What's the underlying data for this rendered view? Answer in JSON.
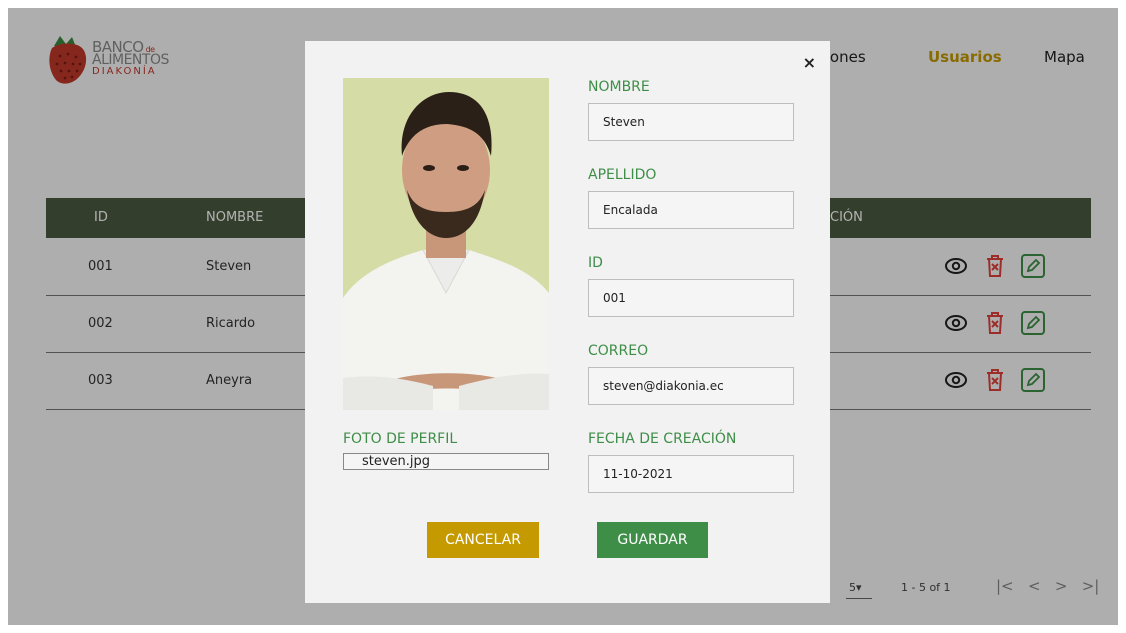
{
  "brand": {
    "line1": "BANCO",
    "line1_small": "de",
    "line2": "ALIMENTOS",
    "line3": "DIAKONÍA"
  },
  "nav": {
    "item_a": "uciones",
    "item_active": "Usuarios",
    "item_c": "Mapa"
  },
  "table": {
    "headers": {
      "id": "ID",
      "nombre": "NOMBRE",
      "right_partial": "CIÓN"
    },
    "rows": [
      {
        "id": "001",
        "nombre": "Steven"
      },
      {
        "id": "002",
        "nombre": "Ricardo"
      },
      {
        "id": "003",
        "nombre": "Aneyra"
      }
    ]
  },
  "pagination": {
    "per_page": "5",
    "range": "1 - 5 of 1"
  },
  "modal": {
    "close_label": "×",
    "photo_label": "FOTO DE PERFIL",
    "photo_file": "steven.jpg",
    "fields": {
      "nombre": {
        "label": "NOMBRE",
        "value": "Steven"
      },
      "apellido": {
        "label": "APELLIDO",
        "value": "Encalada"
      },
      "id": {
        "label": "ID",
        "value": "001"
      },
      "correo": {
        "label": "CORREO",
        "value": "steven@diakonia.ec"
      },
      "fecha": {
        "label": "FECHA DE CREACIÓN",
        "value": "11-10-2021"
      }
    },
    "cancel_label": "CANCELAR",
    "save_label": "GUARDAR"
  },
  "colors": {
    "accent_gold": "#c49a00",
    "accent_green": "#3e8e47",
    "header_dark": "#4a5a40",
    "danger": "#e0413a"
  },
  "icons": [
    "strawberry-logo",
    "eye-icon",
    "trash-icon",
    "edit-icon",
    "close-icon",
    "caret-down-icon",
    "first-page-icon",
    "prev-page-icon",
    "next-page-icon",
    "last-page-icon"
  ]
}
